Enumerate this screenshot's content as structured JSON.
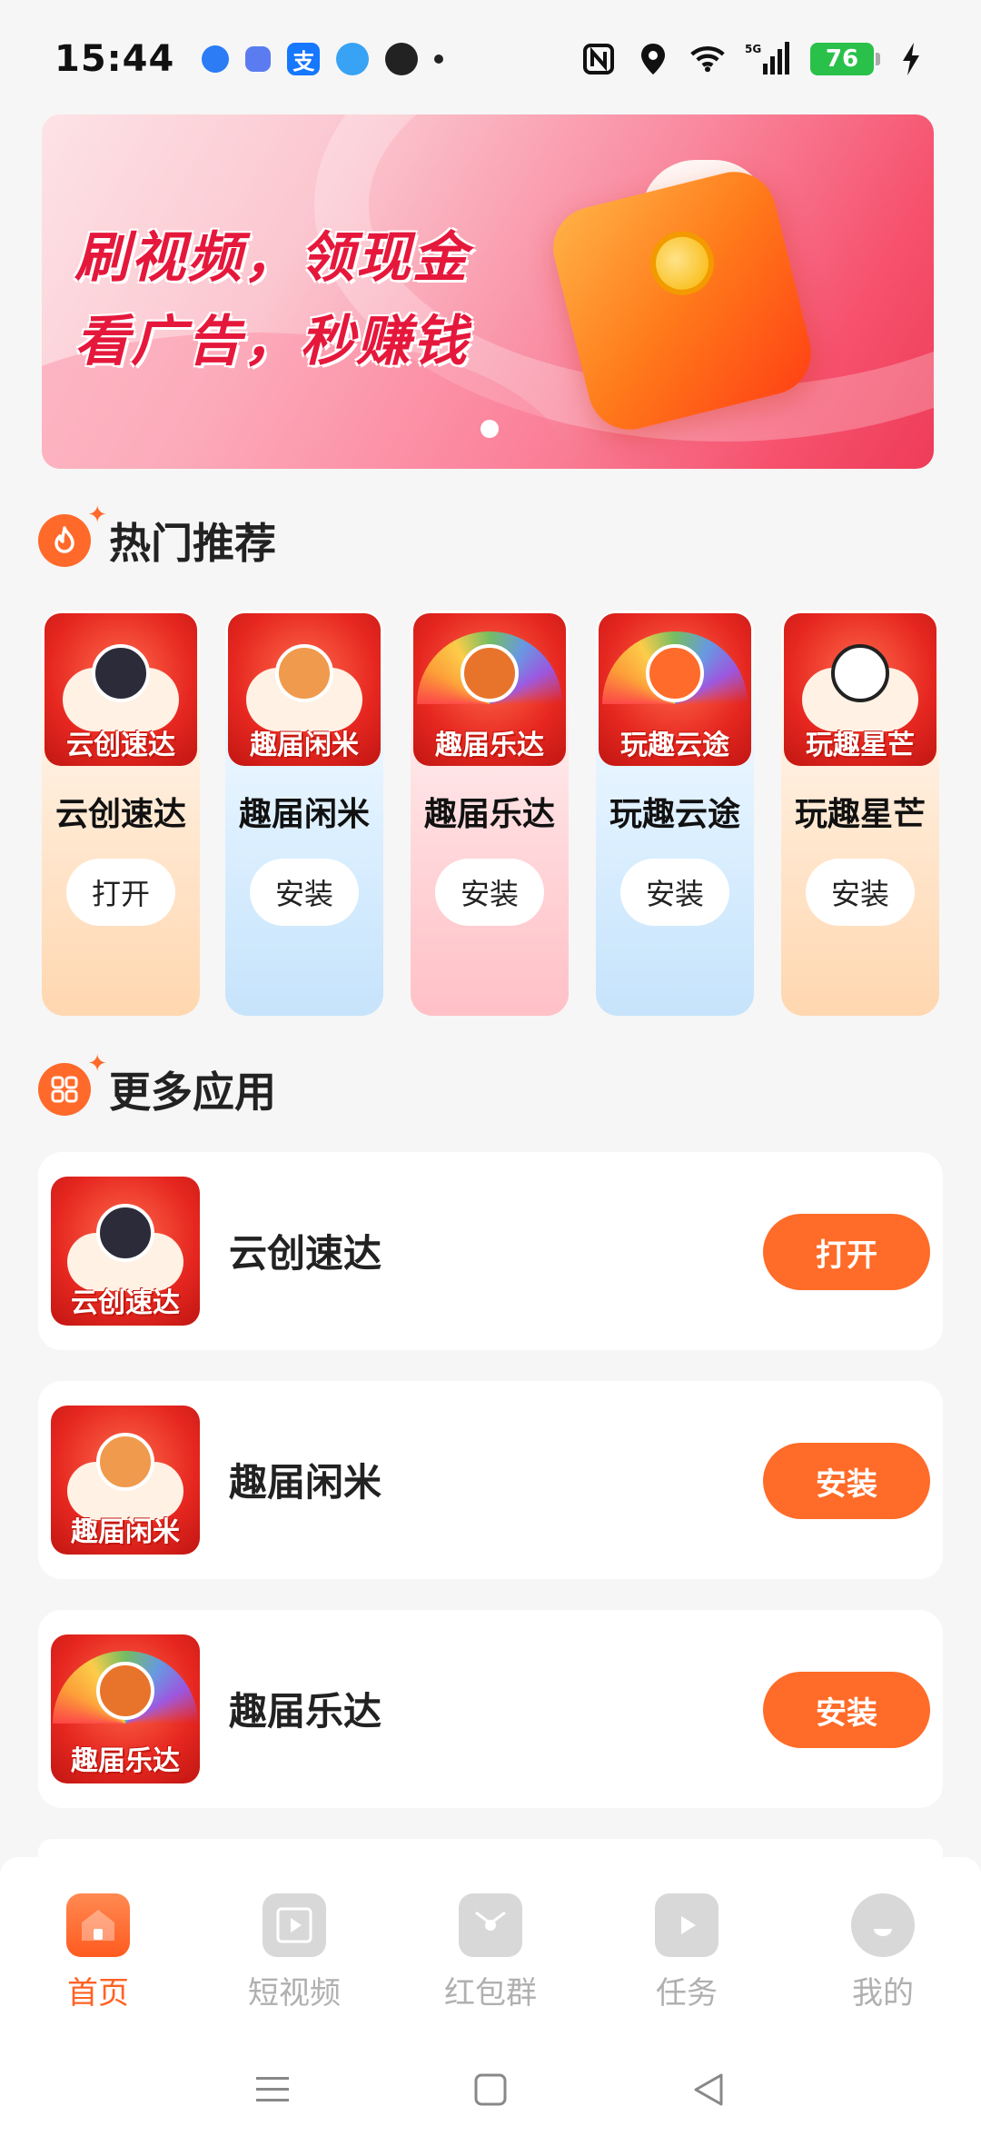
{
  "status_bar": {
    "time": "15:44",
    "battery": "76",
    "network": "5G"
  },
  "banner": {
    "line1": "刷视频，领现金",
    "line2": "看广告，秒赚钱"
  },
  "hot_section": {
    "title": "热门推荐",
    "items": [
      {
        "icon_label": "云创速达",
        "name": "云创速达",
        "button": "打开"
      },
      {
        "icon_label": "趣届闲米",
        "name": "趣届闲米",
        "button": "安装"
      },
      {
        "icon_label": "趣届乐达",
        "name": "趣届乐达",
        "button": "安装"
      },
      {
        "icon_label": "玩趣云途",
        "name": "玩趣云途",
        "button": "安装"
      },
      {
        "icon_label": "玩趣星芒",
        "name": "玩趣星芒",
        "button": "安装"
      }
    ]
  },
  "more_section": {
    "title": "更多应用",
    "items": [
      {
        "icon_label": "云创速达",
        "name": "云创速达",
        "button": "打开"
      },
      {
        "icon_label": "趣届闲米",
        "name": "趣届闲米",
        "button": "安装"
      },
      {
        "icon_label": "趣届乐达",
        "name": "趣届乐达",
        "button": "安装"
      }
    ]
  },
  "bottom_nav": {
    "items": [
      {
        "label": "首页",
        "active": true
      },
      {
        "label": "短视频",
        "active": false
      },
      {
        "label": "红包群",
        "active": false
      },
      {
        "label": "任务",
        "active": false
      },
      {
        "label": "我的",
        "active": false
      }
    ]
  },
  "colors": {
    "accent": "#ff6b28",
    "active_tab": "#ff6224",
    "inactive_tab": "#b0b0b0"
  }
}
